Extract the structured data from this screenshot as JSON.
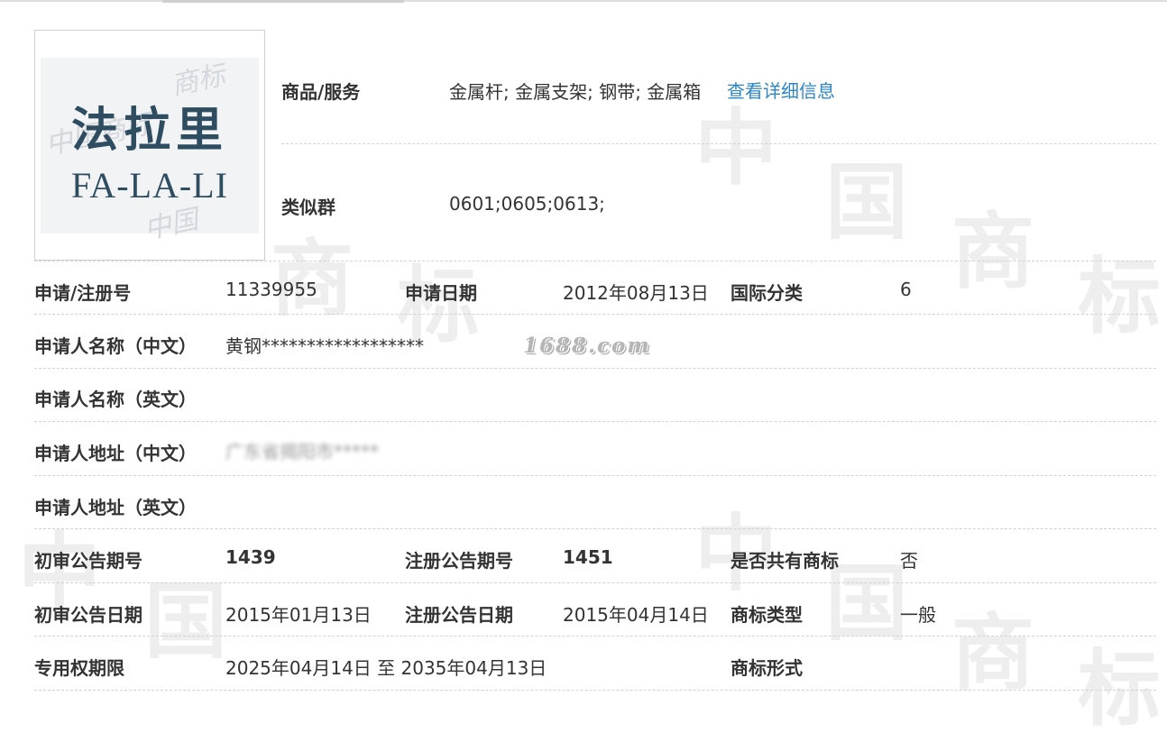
{
  "logo": {
    "text_cn": "法拉里",
    "text_en": "FA-LA-LI"
  },
  "watermark": {
    "site": "1688.com"
  },
  "goods": {
    "label": "商品/服务",
    "value": "金属杆; 金属支架; 钢带; 金属箱",
    "link": "查看详细信息"
  },
  "similar_group": {
    "label": "类似群",
    "value": "0601;0605;0613;"
  },
  "reg_no": {
    "label": "申请/注册号",
    "value": "11339955"
  },
  "apply_date": {
    "label": "申请日期",
    "value": "2012年08月13日"
  },
  "intl_class": {
    "label": "国际分类",
    "value": "6"
  },
  "applicant_cn": {
    "label": "申请人名称（中文）",
    "value": "黄钢******************"
  },
  "applicant_en": {
    "label": "申请人名称（英文）",
    "value": ""
  },
  "address_cn": {
    "label": "申请人地址（中文）",
    "value": "广东省揭阳市*****"
  },
  "address_en": {
    "label": "申请人地址（英文）",
    "value": ""
  },
  "prelim_issue": {
    "label": "初审公告期号",
    "value": "1439"
  },
  "reg_issue": {
    "label": "注册公告期号",
    "value": "1451"
  },
  "shared_mark": {
    "label": "是否共有商标",
    "value": "否"
  },
  "prelim_date": {
    "label": "初审公告日期",
    "value": "2015年01月13日"
  },
  "reg_date": {
    "label": "注册公告日期",
    "value": "2015年04月14日"
  },
  "mark_type": {
    "label": "商标类型",
    "value": "一般"
  },
  "exclusive_period": {
    "label": "专用权期限",
    "value": "2025年04月14日 至 2035年04月13日"
  },
  "mark_form": {
    "label": "商标形式",
    "value": ""
  },
  "colors": {
    "link": "#2c86c8",
    "text": "#333333",
    "divider": "#d2d2d2"
  }
}
